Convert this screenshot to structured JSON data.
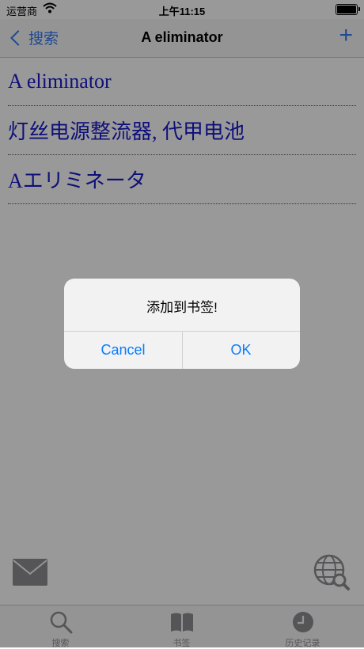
{
  "status_bar": {
    "carrier": "运营商",
    "time": "上午11:15"
  },
  "nav": {
    "back_label": "搜索",
    "title": "A eliminator",
    "add_label": "+"
  },
  "results": [
    {
      "text": "A eliminator"
    },
    {
      "text": "灯丝电源整流器, 代甲电池"
    },
    {
      "text": "Aエリミネータ"
    }
  ],
  "tabs": [
    {
      "label": "搜索",
      "icon": "search-icon"
    },
    {
      "label": "书签",
      "icon": "book-icon"
    },
    {
      "label": "历史记录",
      "icon": "clock-icon"
    }
  ],
  "alert": {
    "message": "添加到书签!",
    "cancel_label": "Cancel",
    "ok_label": "OK"
  },
  "colors": {
    "accent": "#3478f6",
    "link": "#1a1acc",
    "alert_button": "#0a7bff"
  }
}
